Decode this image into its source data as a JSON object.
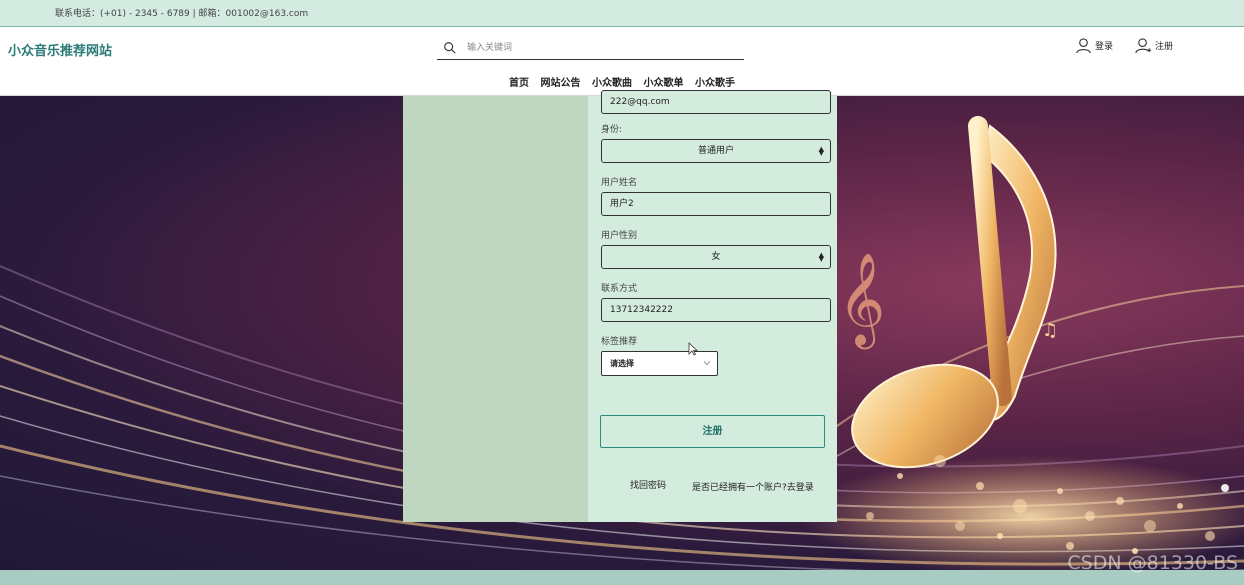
{
  "topbar": {
    "contact": "联系电话：(+01) - 2345 - 6789  |  邮箱：001002@163.com"
  },
  "header": {
    "site_title": "小众音乐推荐网站",
    "search_placeholder": "输入关键词",
    "login_label": "登录",
    "register_label": "注册"
  },
  "nav": {
    "items": [
      "首页",
      "网站公告",
      "小众歌曲",
      "小众歌单",
      "小众歌手"
    ]
  },
  "form": {
    "email_value": "222@qq.com",
    "identity_label": "身份:",
    "identity_value": "普通用户",
    "name_label": "用户姓名",
    "name_value": "用户2",
    "gender_label": "用户性别",
    "gender_value": "女",
    "contact_label": "联系方式",
    "contact_value": "13712342222",
    "tags_label": "标签推荐",
    "tags_value": "请选择",
    "submit_label": "注册",
    "forgot_link": "找回密码",
    "login_link": "是否已经拥有一个账户?去登录"
  },
  "watermark": "CSDN @81330-BS",
  "colors": {
    "accent": "#2b7a78",
    "topbar_bg": "#d3ebe0",
    "form_bg": "#d4ecde",
    "card_left_bg": "#bfd7c1"
  }
}
